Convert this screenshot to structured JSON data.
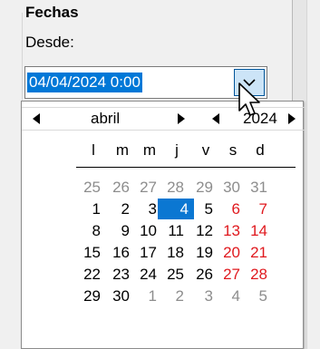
{
  "group": {
    "title": "Fechas",
    "from_label": "Desde:"
  },
  "date_picker": {
    "value": "04/04/2024 0:00",
    "dropdown_icon": "chevron-down-icon"
  },
  "calendar": {
    "month": "abril",
    "year": "2024",
    "weekdays": [
      "l",
      "m",
      "m",
      "j",
      "v",
      "s",
      "d"
    ],
    "weeks": [
      [
        "25",
        "26",
        "27",
        "28",
        "29",
        "30",
        "31"
      ],
      [
        "1",
        "2",
        "3",
        "4",
        "5",
        "6",
        "7"
      ],
      [
        "8",
        "9",
        "10",
        "11",
        "12",
        "13",
        "14"
      ],
      [
        "15",
        "16",
        "17",
        "18",
        "19",
        "20",
        "21"
      ],
      [
        "22",
        "23",
        "24",
        "25",
        "26",
        "27",
        "28"
      ],
      [
        "29",
        "30",
        "1",
        "2",
        "3",
        "4",
        "5"
      ]
    ],
    "selected_day": "4",
    "colors": {
      "selection": "#0b77d2",
      "weekend": "#e0191e",
      "other_month": "#8d8d8d"
    }
  }
}
